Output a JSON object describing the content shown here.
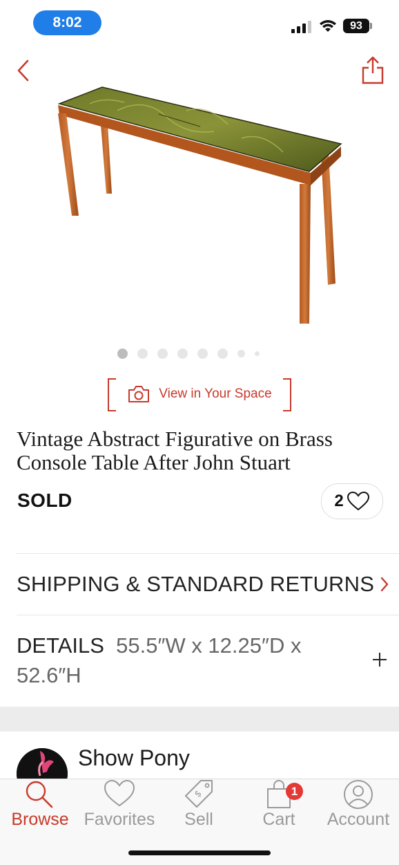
{
  "status": {
    "time": "8:02",
    "battery": "93"
  },
  "product": {
    "title": "Vintage Abstract Figurative on Brass Console Table After John Stuart",
    "status": "SOLD",
    "favorites_count": "2",
    "image_dots": 8,
    "active_dot": 0
  },
  "view_in_space": {
    "label": "View in Your Space"
  },
  "shipping": {
    "label": "SHIPPING & STANDARD RETURNS"
  },
  "details": {
    "label": "DETAILS",
    "value": "55.5″W x 12.25″D x 52.6″H"
  },
  "seller": {
    "name": "Show Pony"
  },
  "tabs": [
    {
      "label": "Browse",
      "icon": "search-icon",
      "active": true
    },
    {
      "label": "Favorites",
      "icon": "heart-icon",
      "active": false
    },
    {
      "label": "Sell",
      "icon": "tag-icon",
      "active": false
    },
    {
      "label": "Cart",
      "icon": "bag-icon",
      "active": false,
      "badge": "1"
    },
    {
      "label": "Account",
      "icon": "user-icon",
      "active": false
    }
  ],
  "colors": {
    "accent": "#c8392b",
    "status_pill": "#1f7ee8",
    "badge": "#e53935"
  }
}
